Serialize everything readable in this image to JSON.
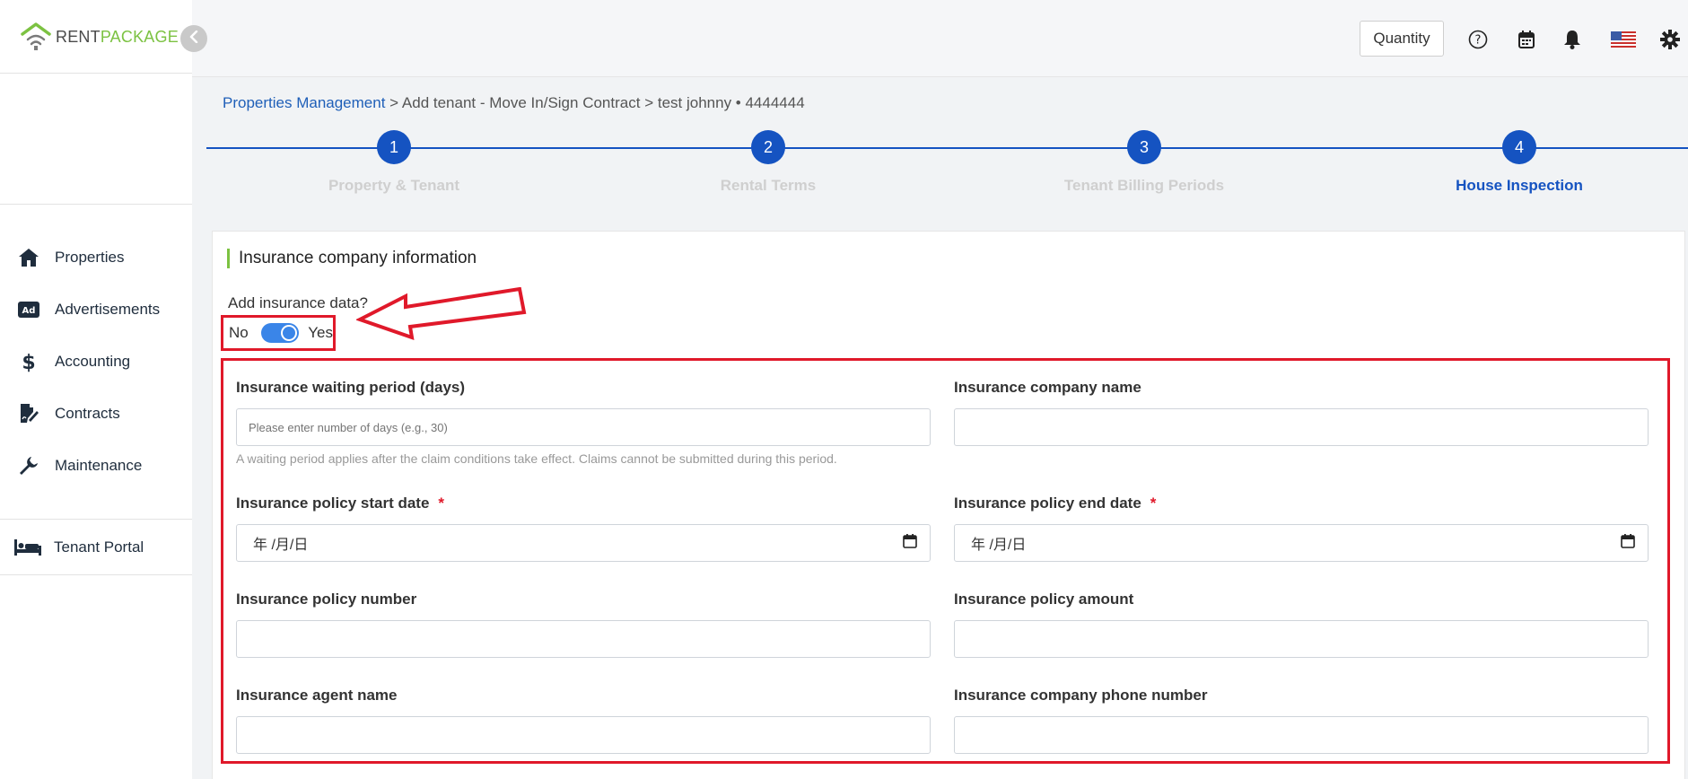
{
  "logo": {
    "rent": "RENT",
    "package": "PACKAGE"
  },
  "sidebar": {
    "items": [
      {
        "label": "Properties",
        "icon": "home-icon"
      },
      {
        "label": "Advertisements",
        "icon": "ad-icon"
      },
      {
        "label": "Accounting",
        "icon": "dollar-icon"
      },
      {
        "label": "Contracts",
        "icon": "contract-icon"
      },
      {
        "label": "Maintenance",
        "icon": "wrench-icon"
      }
    ],
    "tenant_portal": "Tenant Portal"
  },
  "header": {
    "quantity_label": "Quantity",
    "icons": [
      "help-icon",
      "calendar-icon",
      "bell-icon",
      "us-flag-icon",
      "gear-icon"
    ]
  },
  "breadcrumb": {
    "link": "Properties Management",
    "sep1": ">",
    "page": "Add tenant - Move In/Sign Contract",
    "sep2": ">",
    "tenant": "test johnny • 4444444"
  },
  "stepper": {
    "steps": [
      {
        "number": "1",
        "label": "Property & Tenant",
        "active": false
      },
      {
        "number": "2",
        "label": "Rental Terms",
        "active": false
      },
      {
        "number": "3",
        "label": "Tenant Billing Periods",
        "active": false
      },
      {
        "number": "4",
        "label": "House Inspection",
        "active": true
      }
    ]
  },
  "insurance": {
    "title": "Insurance company information",
    "add_question": "Add insurance data?",
    "toggle_off_label": "No",
    "toggle_on_label": "Yes",
    "toggle_value": "Yes",
    "waiting_period": {
      "label": "Insurance waiting period (days)",
      "placeholder": "Please enter number of days (e.g., 30)",
      "hint": "A waiting period applies after the claim conditions take effect. Claims cannot be submitted during this period."
    },
    "company_name": {
      "label": "Insurance company name",
      "value": ""
    },
    "start_date": {
      "label": "Insurance policy start date",
      "required_mark": "*",
      "value": "年 /月/日"
    },
    "end_date": {
      "label": "Insurance policy end date",
      "required_mark": "*",
      "value": "年 /月/日"
    },
    "policy_number": {
      "label": "Insurance policy number",
      "value": ""
    },
    "policy_amount": {
      "label": "Insurance policy amount",
      "value": ""
    },
    "agent_name": {
      "label": "Insurance agent name",
      "value": ""
    },
    "phone_number": {
      "label": "Insurance company phone number",
      "value": ""
    }
  },
  "colors": {
    "primary": "#1553c1",
    "brand_green": "#7cc242",
    "annotation_red": "#e0192a",
    "toggle_blue": "#3a85e8"
  }
}
